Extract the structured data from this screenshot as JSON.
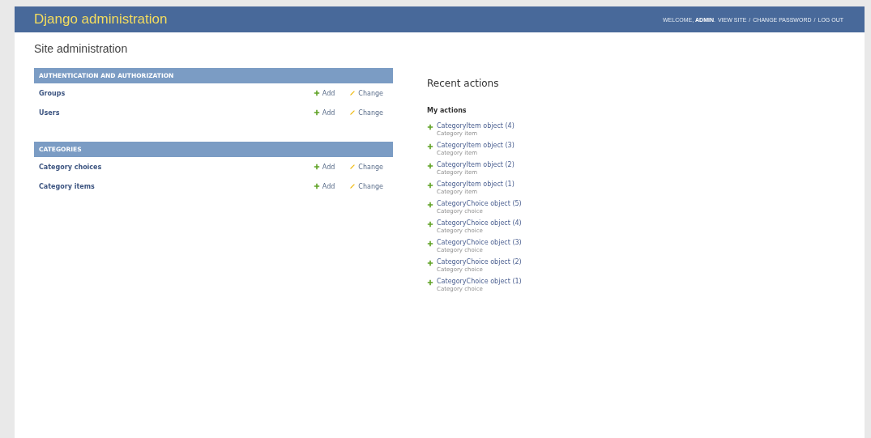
{
  "header": {
    "title": "Django administration",
    "welcome": "WELCOME, **ADMIN**.",
    "links": [
      "VIEW SITE",
      "CHANGE PASSWORD",
      "LOG OUT"
    ],
    "separator": "/"
  },
  "page_title": "Site administration",
  "modules": [
    {
      "caption": "AUTHENTICATION AND AUTHORIZATION",
      "rows": [
        {
          "name": "Groups",
          "add": "Add",
          "change": "Change"
        },
        {
          "name": "Users",
          "add": "Add",
          "change": "Change"
        }
      ]
    },
    {
      "caption": "CATEGORIES",
      "rows": [
        {
          "name": "Category choices",
          "add": "Add",
          "change": "Change"
        },
        {
          "name": "Category items",
          "add": "Add",
          "change": "Change"
        }
      ]
    }
  ],
  "recent_actions": {
    "title": "Recent actions",
    "subtitle": "My actions",
    "items": [
      {
        "kind": "add",
        "label": "CategoryItem object (4)",
        "type": "Category item"
      },
      {
        "kind": "add",
        "label": "CategoryItem object (3)",
        "type": "Category item"
      },
      {
        "kind": "add",
        "label": "CategoryItem object (2)",
        "type": "Category item"
      },
      {
        "kind": "add",
        "label": "CategoryItem object (1)",
        "type": "Category item"
      },
      {
        "kind": "add",
        "label": "CategoryChoice object (5)",
        "type": "Category choice"
      },
      {
        "kind": "add",
        "label": "CategoryChoice object (4)",
        "type": "Category choice"
      },
      {
        "kind": "add",
        "label": "CategoryChoice object (3)",
        "type": "Category choice"
      },
      {
        "kind": "add",
        "label": "CategoryChoice object (2)",
        "type": "Category choice"
      },
      {
        "kind": "add",
        "label": "CategoryChoice object (1)",
        "type": "Category choice"
      }
    ]
  }
}
